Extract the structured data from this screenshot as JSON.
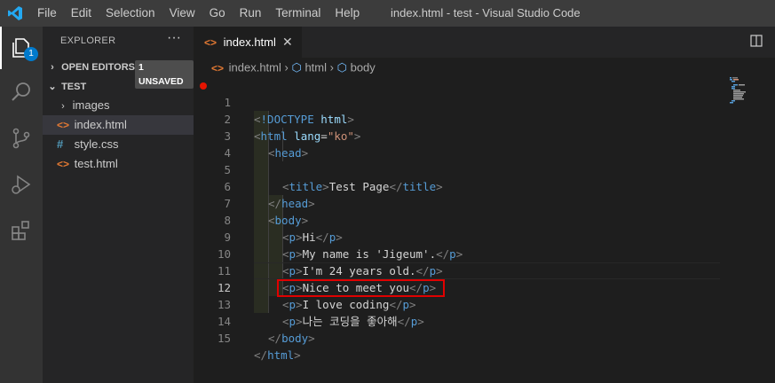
{
  "menu": [
    "File",
    "Edit",
    "Selection",
    "View",
    "Go",
    "Run",
    "Terminal",
    "Help"
  ],
  "window_title": "index.html - test - Visual Studio Code",
  "activity": {
    "badge": "1"
  },
  "explorer": {
    "title": "EXPLORER",
    "more": "···",
    "open_editors": "OPEN EDITORS",
    "unsaved_badge": "1 UNSAVED",
    "folder": "TEST",
    "files": [
      {
        "name": "images",
        "type": "folder"
      },
      {
        "name": "index.html",
        "type": "html"
      },
      {
        "name": "style.css",
        "type": "css"
      },
      {
        "name": "test.html",
        "type": "html"
      }
    ]
  },
  "tab": {
    "label": "index.html",
    "close": "✕"
  },
  "breadcrumb": {
    "file": "index.html",
    "sep": "›",
    "item1": "html",
    "item2": "body"
  },
  "code": {
    "line_numbers": [
      "1",
      "2",
      "3",
      "4",
      "5",
      "6",
      "7",
      "8",
      "9",
      "10",
      "11",
      "12",
      "13",
      "14",
      "15"
    ],
    "doctype_kw": "!DOCTYPE",
    "doctype_val": "html",
    "html_tag": "html",
    "lang_attr": "lang",
    "lang_val": "\"ko\"",
    "head": "head",
    "title": "title",
    "title_text": "Test Page",
    "body": "body",
    "p": "p",
    "lines_text": [
      "Hi",
      "My name is 'Jigeum'.",
      "I'm 24 years old.",
      "Nice to meet you",
      "I love coding",
      "나는 코딩을 좋아해"
    ]
  },
  "colors": {
    "accent": "#007acc",
    "highlight_box": "#e00000",
    "breakpoint": "#e51400"
  }
}
